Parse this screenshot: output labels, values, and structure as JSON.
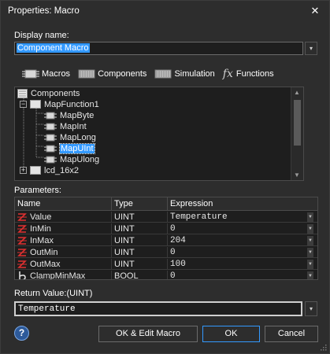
{
  "window": {
    "title": "Properties: Macro",
    "close_glyph": "✕"
  },
  "display_name": {
    "label": "Display name:",
    "value": "Component Macro",
    "dropdown_glyph": "▾"
  },
  "filters": [
    {
      "label": "Macros",
      "icon": "macro-chip-icon"
    },
    {
      "label": "Components",
      "icon": "component-chip-icon"
    },
    {
      "label": "Simulation",
      "icon": "simulation-chip-icon"
    },
    {
      "label": "Functions",
      "icon": "function-fx-icon",
      "glyph": "fx"
    }
  ],
  "tree": {
    "items": [
      {
        "label": "Components",
        "level": 0,
        "expander": "",
        "icon": "components-list-icon"
      },
      {
        "label": "MapFunction1",
        "level": 1,
        "expander": "−",
        "icon": "folder-component-icon"
      },
      {
        "label": "MapByte",
        "level": 2,
        "expander": "",
        "icon": "macro-chip-icon"
      },
      {
        "label": "MapInt",
        "level": 2,
        "expander": "",
        "icon": "macro-chip-icon"
      },
      {
        "label": "MapLong",
        "level": 2,
        "expander": "",
        "icon": "macro-chip-icon"
      },
      {
        "label": "MapUInt",
        "level": 2,
        "expander": "",
        "icon": "macro-chip-icon",
        "selected": true
      },
      {
        "label": "MapUlong",
        "level": 2,
        "expander": "",
        "icon": "macro-chip-icon"
      },
      {
        "label": "lcd_16x2",
        "level": 1,
        "expander": "+",
        "icon": "folder-component-icon"
      }
    ]
  },
  "parameters": {
    "label": "Parameters:",
    "columns": [
      "Name",
      "Type",
      "Expression"
    ],
    "rows": [
      {
        "name": "Value",
        "type": "UINT",
        "expression": "Temperature",
        "icon": "integer-type-icon"
      },
      {
        "name": "InMin",
        "type": "UINT",
        "expression": "0",
        "icon": "integer-type-icon"
      },
      {
        "name": "InMax",
        "type": "UINT",
        "expression": "204",
        "icon": "integer-type-icon"
      },
      {
        "name": "OutMin",
        "type": "UINT",
        "expression": "0",
        "icon": "integer-type-icon"
      },
      {
        "name": "OutMax",
        "type": "UINT",
        "expression": "100",
        "icon": "integer-type-icon"
      },
      {
        "name": "ClampMinMax",
        "type": "BOOL",
        "expression": "0",
        "icon": "bool-type-icon"
      }
    ]
  },
  "return_value": {
    "label": "Return Value:(UINT)",
    "value": "Temperature"
  },
  "buttons": {
    "help": "?",
    "ok_edit": "OK & Edit Macro",
    "ok": "OK",
    "cancel": "Cancel"
  }
}
